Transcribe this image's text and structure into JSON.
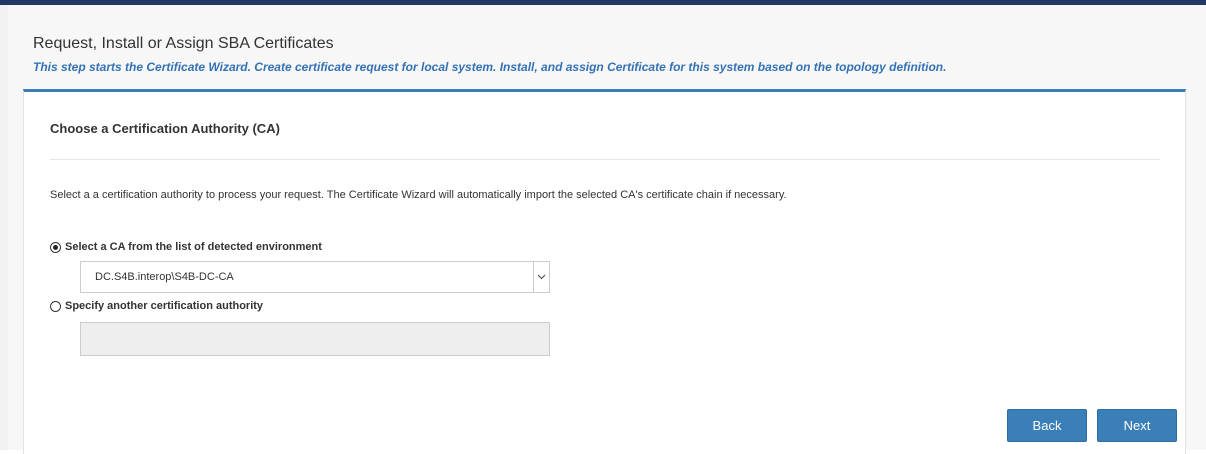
{
  "header": {
    "title": "Request, Install or Assign SBA Certificates",
    "subtitle": "This step starts the Certificate Wizard. Create certificate request for local system. Install, and assign Certificate for this system based on the topology definition."
  },
  "panel": {
    "heading": "Choose a Certification Authority (CA)",
    "description": "Select a a certification authority to process your request. The Certificate Wizard will automatically import the selected CA's certificate chain if necessary.",
    "option_detected": {
      "label": "Select a CA from the list of detected environment",
      "checked": true
    },
    "ca_select": {
      "value": "DC.S4B.interop\\S4B-DC-CA",
      "arrow_icon": "chevron-down-icon"
    },
    "option_other": {
      "label": "Specify another certification authority",
      "checked": false
    },
    "other_ca_input": {
      "value": "",
      "placeholder": ""
    }
  },
  "buttons": {
    "back_label": "Back",
    "next_label": "Next"
  },
  "colors": {
    "accent": "#3b7fb9",
    "subtitle": "#3472b5",
    "top_bar": "#1f3864"
  }
}
